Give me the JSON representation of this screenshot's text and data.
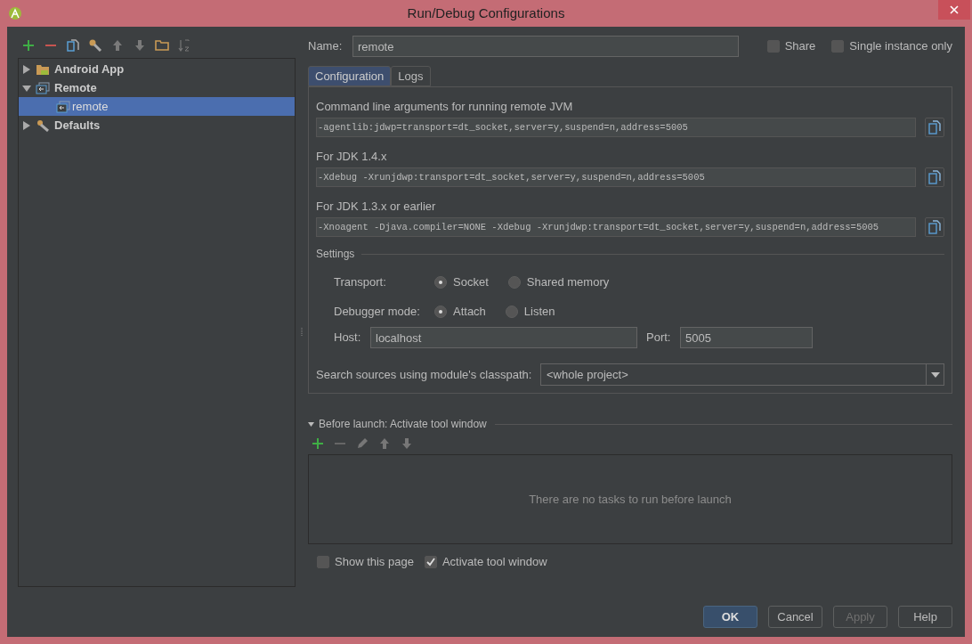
{
  "window": {
    "title": "Run/Debug Configurations"
  },
  "tree": [
    {
      "label": "Android App",
      "kind": "android",
      "expanded": false,
      "selected": false
    },
    {
      "label": "Remote",
      "kind": "remote",
      "expanded": true,
      "selected": false,
      "children": [
        {
          "label": "remote",
          "kind": "remote",
          "selected": true
        }
      ]
    },
    {
      "label": "Defaults",
      "kind": "wrench",
      "expanded": false,
      "selected": false
    }
  ],
  "name": {
    "label": "Name:",
    "value": "remote"
  },
  "options": [
    {
      "label": "Share",
      "checked": false
    },
    {
      "label": "Single instance only",
      "checked": false
    }
  ],
  "tabs": [
    {
      "label": "Configuration",
      "selected": true
    },
    {
      "label": "Logs",
      "selected": false
    }
  ],
  "arguments": [
    {
      "label": "Command line arguments for running remote JVM",
      "value": "-agentlib:jdwp=transport=dt_socket,server=y,suspend=n,address=5005"
    },
    {
      "label": "For JDK 1.4.x",
      "value": "-Xdebug -Xrunjdwp:transport=dt_socket,server=y,suspend=n,address=5005"
    },
    {
      "label": "For JDK 1.3.x or earlier",
      "value": "-Xnoagent -Djava.compiler=NONE -Xdebug -Xrunjdwp:transport=dt_socket,server=y,suspend=n,address=5005"
    }
  ],
  "settings": {
    "title": "Settings",
    "radio_groups": [
      {
        "label": "Transport:",
        "options": [
          {
            "label": "Socket",
            "selected": true
          },
          {
            "label": "Shared memory",
            "selected": false
          }
        ]
      },
      {
        "label": "Debugger mode:",
        "options": [
          {
            "label": "Attach",
            "selected": true
          },
          {
            "label": "Listen",
            "selected": false
          }
        ]
      }
    ],
    "host": {
      "label": "Host:",
      "value": "localhost"
    },
    "port": {
      "label": "Port:",
      "value": "5005"
    },
    "search_sources": {
      "label": "Search sources using module's classpath:",
      "value": "<whole project>"
    }
  },
  "before_launch": {
    "title": "Before launch: Activate tool window",
    "expanded": true,
    "empty_text": "There are no tasks to run before launch"
  },
  "bottom_options": [
    {
      "label": "Show this page",
      "checked": false
    },
    {
      "label": "Activate tool window",
      "checked": true
    }
  ],
  "buttons": [
    {
      "label": "OK",
      "kind": "primary",
      "disabled": false
    },
    {
      "label": "Cancel",
      "kind": "normal",
      "disabled": false
    },
    {
      "label": "Apply",
      "kind": "normal",
      "disabled": true
    },
    {
      "label": "Help",
      "kind": "normal",
      "disabled": false
    }
  ]
}
